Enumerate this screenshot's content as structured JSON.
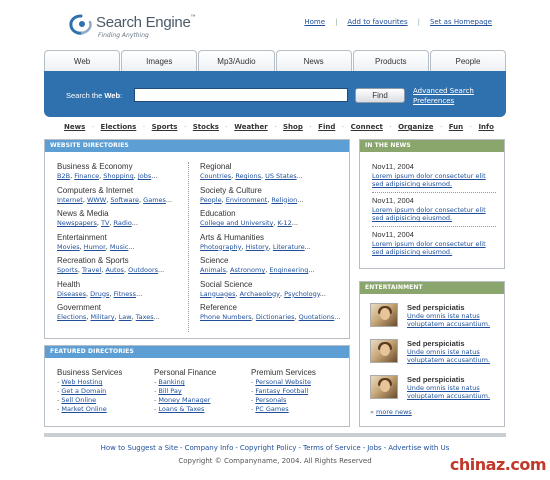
{
  "header": {
    "logo_title": "Search Engine",
    "logo_tm": "™",
    "logo_tagline": "Finding Anything",
    "top_links": [
      "Home",
      "Add to favourites",
      "Set as Homepage"
    ]
  },
  "tabs": [
    "Web",
    "Images",
    "Mp3/Audio",
    "News",
    "Products",
    "People"
  ],
  "search": {
    "label_prefix": "Search the ",
    "label_bold": "Web",
    "label_suffix": ":",
    "input_value": "",
    "button_label": "Find",
    "advanced_link": "Advanced Search",
    "preferences_link": "Preferences"
  },
  "quick_nav": [
    "News",
    "Elections",
    "Sports",
    "Stocks",
    "Weather",
    "Shop",
    "Find",
    "Connect",
    "Organize",
    "Fun",
    "Info"
  ],
  "directories": {
    "heading": "WEBSITE DIRECTORIES",
    "left": [
      {
        "title": "Business & Economy",
        "links": [
          "B2B",
          "Finance",
          "Shopping",
          "Jobs"
        ]
      },
      {
        "title": "Computers & Internet",
        "links": [
          "Internet",
          "WWW",
          "Software",
          "Games"
        ]
      },
      {
        "title": "News & Media",
        "links": [
          "Newspapers",
          "TV",
          "Radio"
        ]
      },
      {
        "title": "Entertainment",
        "links": [
          "Movies",
          "Humor",
          "Music"
        ]
      },
      {
        "title": "Recreation & Sports",
        "links": [
          "Sports",
          "Travel",
          "Autos",
          "Outdoors"
        ]
      },
      {
        "title": "Health",
        "links": [
          "Diseases",
          "Drugs",
          "Fitness"
        ]
      },
      {
        "title": "Government",
        "links": [
          "Elections",
          "Military",
          "Law",
          "Taxes"
        ]
      }
    ],
    "right": [
      {
        "title": "Regional",
        "links": [
          "Countries",
          "Regions",
          "US States"
        ]
      },
      {
        "title": "Society & Culture",
        "links": [
          "People",
          "Environment",
          "Religion"
        ]
      },
      {
        "title": "Education",
        "links": [
          "College and University",
          "K-12"
        ]
      },
      {
        "title": "Arts & Humanities",
        "links": [
          "Photography",
          "History",
          "Literature"
        ]
      },
      {
        "title": "Science",
        "links": [
          "Animals",
          "Astronomy",
          "Engineering"
        ]
      },
      {
        "title": "Social Science",
        "links": [
          "Languages",
          "Archaeology",
          "Psychology"
        ]
      },
      {
        "title": "Reference",
        "links": [
          "Phone Numbers",
          "Dictionaries",
          "Quotations"
        ]
      }
    ]
  },
  "featured": {
    "heading": "FEATURED DIRECTORIES",
    "columns": [
      {
        "title": "Business Services",
        "links": [
          "Web Hosting",
          "Get a Domain",
          "Sell Online",
          "Market Online"
        ]
      },
      {
        "title": "Personal Finance",
        "links": [
          "Banking",
          "Bill Pay",
          "Money Manager",
          "Loans & Taxes"
        ]
      },
      {
        "title": "Premium Services",
        "links": [
          "Personal Website",
          "Fantasy Football",
          "Personals",
          "PC Games"
        ]
      }
    ]
  },
  "news": {
    "heading": "IN THE NEWS",
    "items": [
      {
        "date": "Nov11, 2004",
        "text": "Lorem ipsum dolor consectetur elit sed adipisicing eiusmod."
      },
      {
        "date": "Nov11, 2004",
        "text": "Lorem ipsum dolor consectetur elit sed adipisicing eiusmod."
      },
      {
        "date": "Nov11, 2004",
        "text": "Lorem ipsum dolor consectetur elit sed adipisicing eiusmod."
      }
    ]
  },
  "entertainment": {
    "heading": "ENTERTAINMENT",
    "items": [
      {
        "title": "Sed perspiciatis",
        "text": "Unde omnis iste natus voluptatem accusantium."
      },
      {
        "title": "Sed perspiciatis",
        "text": "Unde omnis iste natus voluptatem accusantium."
      },
      {
        "title": "Sed perspiciatis",
        "text": "Unde omnis iste natus voluptatem accusantium."
      }
    ],
    "more_link": "more news"
  },
  "footer": {
    "links": [
      "How to Suggest a Site",
      "Company Info",
      "Copyright Policy",
      "Terms of Service",
      "Jobs",
      "Advertise with Us"
    ],
    "copyright": "Copyright © Companyname, 2004. All Rights Reserved"
  },
  "watermark": "chinaz.com",
  "colors": {
    "search_band": "#2f70ae",
    "panel_head_blue": "#5d9fd4",
    "panel_head_green": "#8aa66c",
    "link": "#1f4f9a"
  }
}
